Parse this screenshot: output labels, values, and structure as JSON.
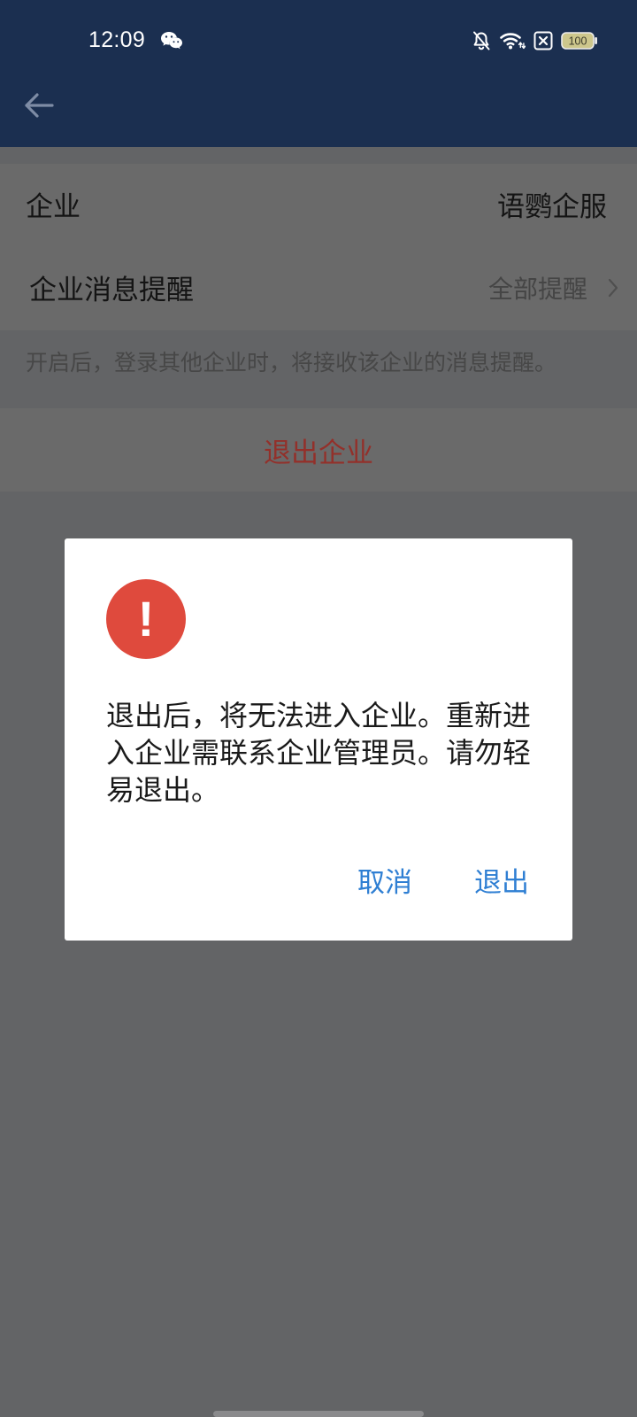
{
  "status_bar": {
    "time": "12:09",
    "battery_level": "100",
    "icons": {
      "notification": "wechat-icon",
      "ringer": "bell-off-icon",
      "network": "wifi-icon",
      "sim": "no-sim-icon",
      "battery": "battery-icon"
    }
  },
  "header": {
    "back_icon": "arrow-left-icon"
  },
  "page": {
    "company_row": {
      "label": "企业",
      "value": "语鹦企服"
    },
    "notify_row": {
      "label": "企业消息提醒",
      "value": "全部提醒",
      "icon": "chevron-right-icon"
    },
    "notify_hint": "开启后，登录其他企业时，将接收该企业的消息提醒。",
    "exit_button": "退出企业"
  },
  "dialog": {
    "icon": "exclamation-icon",
    "icon_glyph": "!",
    "message": "退出后，将无法进入企业。重新进入企业需联系企业管理员。请勿轻易退出。",
    "cancel_label": "取消",
    "confirm_label": "退出"
  },
  "colors": {
    "header_background": "#1b2f50",
    "alert_red": "#df4a3d",
    "danger_text": "#93302a",
    "action_blue": "#2f7fd3",
    "scrim_background": "#636466"
  }
}
